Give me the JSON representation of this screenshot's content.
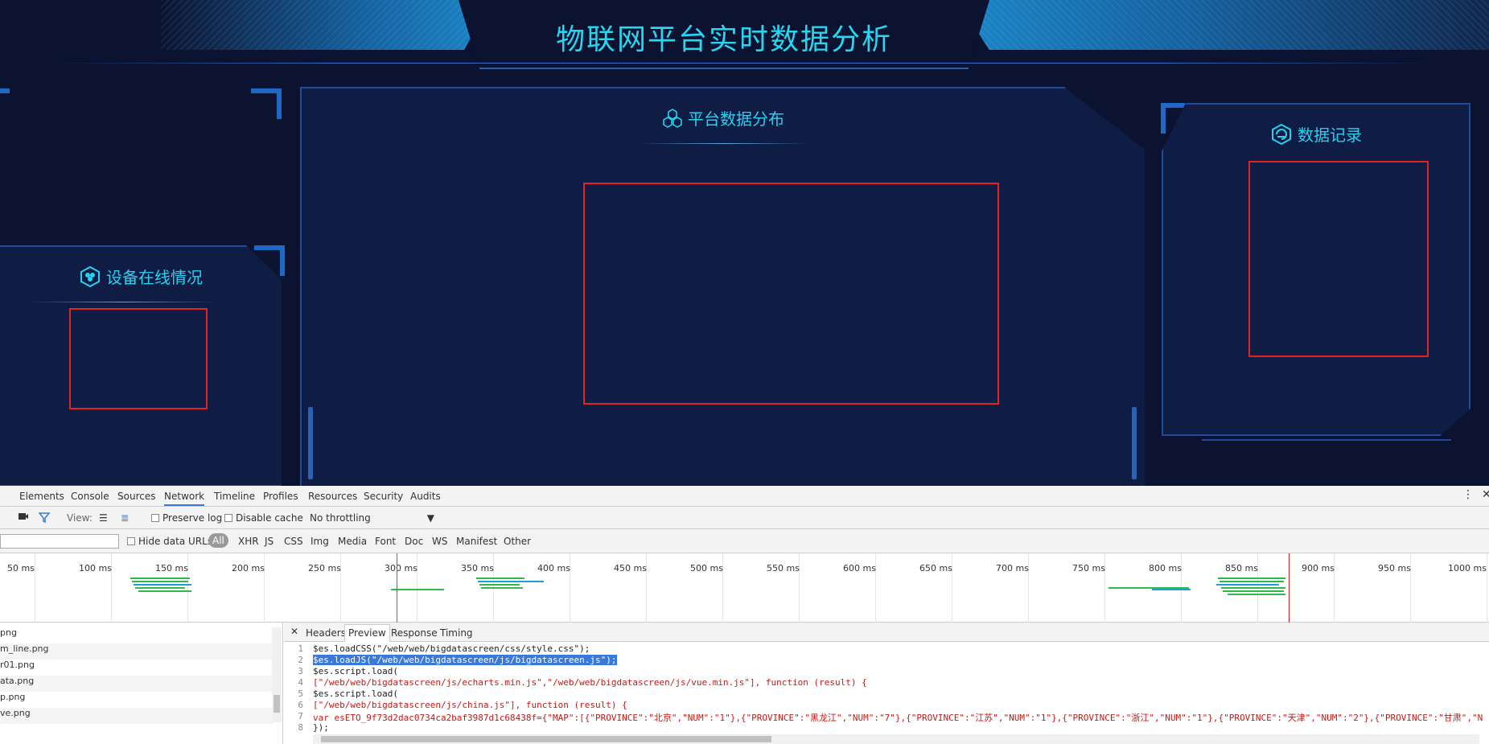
{
  "header": {
    "title": "物联网平台实时数据分析"
  },
  "panels": {
    "online": {
      "title": "设备在线情况"
    },
    "platform": {
      "title": "平台数据分布"
    },
    "record": {
      "title": "数据记录"
    }
  },
  "devtools": {
    "tabs": [
      "Elements",
      "Console",
      "Sources",
      "Network",
      "Timeline",
      "Profiles",
      "Resources",
      "Security",
      "Audits"
    ],
    "active_tab": "Network",
    "toolbar": {
      "view_label": "View:",
      "preserve_log": "Preserve log",
      "disable_cache": "Disable cache",
      "throttling": "No throttling"
    },
    "filter": {
      "hide_data_urls": "Hide data URLs",
      "types": [
        "All",
        "XHR",
        "JS",
        "CSS",
        "Img",
        "Media",
        "Font",
        "Doc",
        "WS",
        "Manifest",
        "Other"
      ]
    },
    "timeline_ticks": [
      "50 ms",
      "100 ms",
      "150 ms",
      "200 ms",
      "250 ms",
      "300 ms",
      "350 ms",
      "400 ms",
      "450 ms",
      "500 ms",
      "550 ms",
      "600 ms",
      "650 ms",
      "700 ms",
      "750 ms",
      "800 ms",
      "850 ms",
      "900 ms",
      "950 ms",
      "1000 ms"
    ],
    "files": [
      "png",
      "m_line.png",
      "r01.png",
      "ata.png",
      "p.png",
      "ve.png"
    ],
    "preview_tabs": [
      "Headers",
      "Preview",
      "Response",
      "Timing"
    ],
    "preview_active": "Preview",
    "code_lines": [
      "$es.loadCSS(\"/web/web/bigdatascreen/css/style.css\");",
      "$es.loadJS(\"/web/web/bigdatascreen/js/bigdatascreen.js\");",
      "$es.script.load(",
      "[\"/web/web/bigdatascreen/js/echarts.min.js\",\"/web/web/bigdatascreen/js/vue.min.js\"], function (result) {",
      "$es.script.load(",
      "[\"/web/web/bigdatascreen/js/china.js\"], function (result) {",
      "var esETO_9f73d2dac0734ca2baf3987d1c68438f={\"MAP\":[{\"PROVINCE\":\"北京\",\"NUM\":\"1\"},{\"PROVINCE\":\"黑龙江\",\"NUM\":\"7\"},{\"PROVINCE\":\"江苏\",\"NUM\":\"1\"},{\"PROVINCE\":\"浙江\",\"NUM\":\"1\"},{\"PROVINCE\":\"天津\",\"NUM\":\"2\"},{\"PROVINCE\":\"甘肃\",\"N",
      "});"
    ],
    "line_numbers": [
      "1",
      "2",
      "3",
      "4",
      "5",
      "6",
      "7",
      "8"
    ]
  }
}
